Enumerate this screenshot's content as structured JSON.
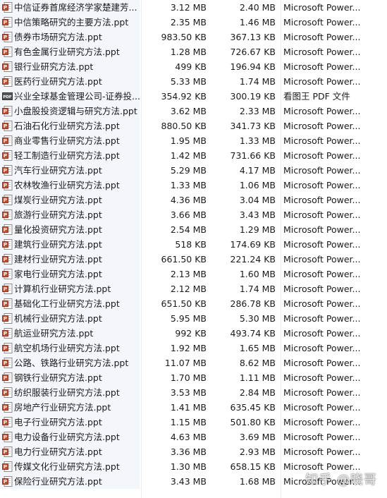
{
  "rows": [
    {
      "icon": "ppt-icon",
      "name": "中信证券首席经济学家楚建芳...",
      "size": "3.12 MB",
      "compressed": "2.40 MB",
      "type": "Microsoft Power..."
    },
    {
      "icon": "ppt-icon",
      "name": "中信策略研究的主要方法.ppt",
      "size": "2.35 MB",
      "compressed": "1.46 MB",
      "type": "Microsoft Power..."
    },
    {
      "icon": "ppt-icon",
      "name": "债券市场研究方法.ppt",
      "size": "983.50 KB",
      "compressed": "367.13 KB",
      "type": "Microsoft Power..."
    },
    {
      "icon": "ppt-icon",
      "name": "有色金属行业研究方法.ppt",
      "size": "1.28 MB",
      "compressed": "726.67 KB",
      "type": "Microsoft Power..."
    },
    {
      "icon": "ppt-icon",
      "name": "银行业研究方法.ppt",
      "size": "499 KB",
      "compressed": "196.94 KB",
      "type": "Microsoft Power..."
    },
    {
      "icon": "ppt-icon",
      "name": "医药行业研究方法.ppt",
      "size": "5.33 MB",
      "compressed": "1.74 MB",
      "type": "Microsoft Power..."
    },
    {
      "icon": "pdf-icon",
      "name": "兴业全球基金管理公司-证券投...",
      "size": "354.92 KB",
      "compressed": "300.19 KB",
      "type": "看图王 PDF 文件"
    },
    {
      "icon": "ppt-icon",
      "name": "小盘股投资逻辑与研究方法.ppt",
      "size": "3.62 MB",
      "compressed": "2.33 MB",
      "type": "Microsoft Power..."
    },
    {
      "icon": "ppt-icon",
      "name": "石油石化行业研究方法.ppt",
      "size": "880.50 KB",
      "compressed": "341.73 KB",
      "type": "Microsoft Power..."
    },
    {
      "icon": "ppt-icon",
      "name": "商业零售行业研究方法.ppt",
      "size": "1.95 MB",
      "compressed": "1.33 MB",
      "type": "Microsoft Power..."
    },
    {
      "icon": "ppt-icon",
      "name": "轻工制造行业研究方法.ppt",
      "size": "1.42 MB",
      "compressed": "731.66 KB",
      "type": "Microsoft Power..."
    },
    {
      "icon": "ppt-icon",
      "name": "汽车行业研究方法.ppt",
      "size": "5.29 MB",
      "compressed": "4.17 MB",
      "type": "Microsoft Power..."
    },
    {
      "icon": "ppt-icon",
      "name": "农林牧渔行业研究方法.ppt",
      "size": "1.33 MB",
      "compressed": "1.06 MB",
      "type": "Microsoft Power..."
    },
    {
      "icon": "ppt-icon",
      "name": "煤炭行业研究方法.ppt",
      "size": "4.36 MB",
      "compressed": "3.04 MB",
      "type": "Microsoft Power..."
    },
    {
      "icon": "ppt-icon",
      "name": "旅游行业研究方法.ppt",
      "size": "3.66 MB",
      "compressed": "3.43 MB",
      "type": "Microsoft Power..."
    },
    {
      "icon": "ppt-icon",
      "name": "量化投资研究方法.ppt",
      "size": "2.54 MB",
      "compressed": "1.29 MB",
      "type": "Microsoft Power..."
    },
    {
      "icon": "ppt-icon",
      "name": "建筑行业研究方法.ppt",
      "size": "518 KB",
      "compressed": "174.69 KB",
      "type": "Microsoft Power..."
    },
    {
      "icon": "ppt-icon",
      "name": "建材行业研究方法.ppt",
      "size": "661.50 KB",
      "compressed": "221.24 KB",
      "type": "Microsoft Power..."
    },
    {
      "icon": "ppt-icon",
      "name": "家电行业研究方法.ppt",
      "size": "2.13 MB",
      "compressed": "1.60 MB",
      "type": "Microsoft Power..."
    },
    {
      "icon": "ppt-icon",
      "name": "计算机行业研究方法.ppt",
      "size": "2.12 MB",
      "compressed": "1.74 MB",
      "type": "Microsoft Power..."
    },
    {
      "icon": "ppt-icon",
      "name": "基础化工行业研究方法.ppt",
      "size": "651.50 KB",
      "compressed": "286.78 KB",
      "type": "Microsoft Power..."
    },
    {
      "icon": "ppt-icon",
      "name": "机械行业研究方法.ppt",
      "size": "5.95 MB",
      "compressed": "5.30 MB",
      "type": "Microsoft Power..."
    },
    {
      "icon": "ppt-icon",
      "name": "航运业研究方法.ppt",
      "size": "992 KB",
      "compressed": "493.74 KB",
      "type": "Microsoft Power..."
    },
    {
      "icon": "ppt-icon",
      "name": "航空机场行业研究方法.ppt",
      "size": "1.92 MB",
      "compressed": "1.65 MB",
      "type": "Microsoft Power..."
    },
    {
      "icon": "ppt-icon",
      "name": "公路、铁路行业研究方法.ppt",
      "size": "11.07 MB",
      "compressed": "8.62 MB",
      "type": "Microsoft Power..."
    },
    {
      "icon": "ppt-icon",
      "name": "钢铁行业研究方法.ppt",
      "size": "1.70 MB",
      "compressed": "1.11 MB",
      "type": "Microsoft Power..."
    },
    {
      "icon": "ppt-icon",
      "name": "纺织服装行业研究方法.ppt",
      "size": "3.53 MB",
      "compressed": "2.84 MB",
      "type": "Microsoft Power..."
    },
    {
      "icon": "ppt-icon",
      "name": "房地产行业研究方法.ppt",
      "size": "1.41 MB",
      "compressed": "635.45 KB",
      "type": "Microsoft Power..."
    },
    {
      "icon": "ppt-icon",
      "name": "电子行业研究方法.ppt",
      "size": "1.15 MB",
      "compressed": "501.80 KB",
      "type": "Microsoft Power..."
    },
    {
      "icon": "ppt-icon",
      "name": "电力设备行业研究方法.ppt",
      "size": "4.63 MB",
      "compressed": "3.69 MB",
      "type": "Microsoft Power..."
    },
    {
      "icon": "ppt-icon",
      "name": "电力行业研究方法.ppt",
      "size": "3.36 MB",
      "compressed": "2.93 MB",
      "type": "Microsoft Power..."
    },
    {
      "icon": "ppt-icon",
      "name": "传媒文化行业研究方法.ppt",
      "size": "1.30 MB",
      "compressed": "658.15 KB",
      "type": "Microsoft Power..."
    },
    {
      "icon": "ppt-icon",
      "name": "保险行业研究方法.ppt",
      "size": "3.43 MB",
      "compressed": "1.68 MB",
      "type": "Microsoft Power..."
    }
  ],
  "watermark": "知乎 @晓哥",
  "colors": {
    "name_column_bg": "#f3f6fb",
    "ppt_icon": "#c9502a",
    "pdf_icon": "#444444"
  }
}
